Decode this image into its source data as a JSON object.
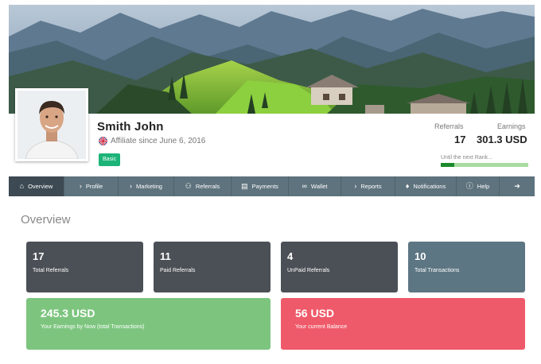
{
  "profile": {
    "name": "Smith John",
    "affiliate_since": "Affiliate since June 6, 2016",
    "badge": "Basic"
  },
  "stats": {
    "referrals_label": "Referrals",
    "earnings_label": "Earnings",
    "referrals_value": "17",
    "earnings_value": "301.3 USD",
    "rank_label": "Until the next Rank...",
    "rank_progress_fraction": 0.15
  },
  "nav": {
    "items": [
      {
        "label": "Overview",
        "icon": "home-icon"
      },
      {
        "label": "Profile",
        "icon": "chevron-right-icon"
      },
      {
        "label": "Marketing",
        "icon": "chevron-right-icon"
      },
      {
        "label": "Referrals",
        "icon": "users-icon"
      },
      {
        "label": "Payments",
        "icon": "money-icon"
      },
      {
        "label": "Wallet",
        "icon": "link-icon"
      },
      {
        "label": "Reports",
        "icon": "chevron-right-icon"
      },
      {
        "label": "Notifications",
        "icon": "bell-icon"
      },
      {
        "label": "Help",
        "icon": "question-icon"
      },
      {
        "label": "",
        "icon": "logout-icon"
      }
    ]
  },
  "overview": {
    "title": "Overview",
    "cards": [
      {
        "value": "17",
        "label": "Total Referrals",
        "color": "#4b5056"
      },
      {
        "value": "11",
        "label": "Paid Referrals",
        "color": "#4b5056"
      },
      {
        "value": "4",
        "label": "UnPaid Referrals",
        "color": "#4b5056"
      },
      {
        "value": "10",
        "label": "Total Transactions",
        "color": "#5d7683"
      }
    ],
    "big_cards": [
      {
        "value": "245.3 USD",
        "label": "Your Earnings by Now (total Transactions)",
        "color": "#7dc57f"
      },
      {
        "value": "56 USD",
        "label": "Your current Balance",
        "color": "#ef5a6a"
      }
    ]
  }
}
